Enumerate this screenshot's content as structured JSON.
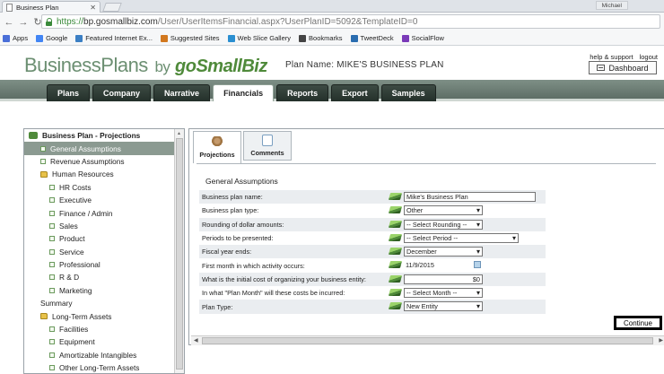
{
  "browser": {
    "tab_title": "Business Plan",
    "user_chip": "Michael",
    "url_proto": "https://",
    "url_host": "bp.gosmallbiz.com",
    "url_path": "/User/UserItemsFinancial.aspx?UserPlanID=5092&TemplateID=0",
    "bookmarks": [
      "Apps",
      "Google",
      "Featured Internet Ex...",
      "Suggested Sites",
      "Web Slice Gallery",
      "Bookmarks",
      "TweetDeck",
      "SocialFlow"
    ],
    "bookmark_colors": [
      "#4a6fd8",
      "#4285f4",
      "#3b7fc4",
      "#d2781e",
      "#2a8fd1",
      "#444444",
      "#2a6db0",
      "#7a3ab8"
    ]
  },
  "header": {
    "brand_main": "BusinessPlans",
    "brand_by": "by",
    "brand_gos": "goSmallBiz",
    "plan_name": "Plan Name: MIKE'S BUSINESS PLAN",
    "help_link": "help & support",
    "logout_link": "logout",
    "dashboard_label": "Dashboard"
  },
  "nav": {
    "tabs": [
      "Plans",
      "Company",
      "Narrative",
      "Financials",
      "Reports",
      "Export",
      "Samples"
    ],
    "active": "Financials"
  },
  "sidebar": {
    "items": [
      {
        "label": "Business Plan - Projections",
        "level": 0,
        "kind": "root"
      },
      {
        "label": "General Assumptions",
        "level": 1,
        "kind": "leaf",
        "selected": true
      },
      {
        "label": "Revenue Assumptions",
        "level": 1,
        "kind": "leaf"
      },
      {
        "label": "Human Resources",
        "level": 1,
        "kind": "folder"
      },
      {
        "label": "HR Costs",
        "level": 2,
        "kind": "leaf"
      },
      {
        "label": "Executive",
        "level": 2,
        "kind": "leaf"
      },
      {
        "label": "Finance / Admin",
        "level": 2,
        "kind": "leaf"
      },
      {
        "label": "Sales",
        "level": 2,
        "kind": "leaf"
      },
      {
        "label": "Product",
        "level": 2,
        "kind": "leaf"
      },
      {
        "label": "Service",
        "level": 2,
        "kind": "leaf"
      },
      {
        "label": "Professional",
        "level": 2,
        "kind": "leaf"
      },
      {
        "label": "R & D",
        "level": 2,
        "kind": "leaf"
      },
      {
        "label": "Marketing",
        "level": 2,
        "kind": "leaf"
      },
      {
        "label": "Summary",
        "level": 1,
        "kind": "plain"
      },
      {
        "label": "Long-Term Assets",
        "level": 1,
        "kind": "folder"
      },
      {
        "label": "Facilities",
        "level": 2,
        "kind": "leaf"
      },
      {
        "label": "Equipment",
        "level": 2,
        "kind": "leaf"
      },
      {
        "label": "Amortizable Intangibles",
        "level": 2,
        "kind": "leaf"
      },
      {
        "label": "Other Long-Term Assets",
        "level": 2,
        "kind": "leaf"
      }
    ]
  },
  "panel": {
    "subtabs": [
      "Projections",
      "Comments"
    ],
    "section_title": "General Assumptions",
    "rows": [
      {
        "label": "Business plan name:",
        "control": "text",
        "value": "Mike's Business Plan",
        "width": "wide"
      },
      {
        "label": "Business plan type:",
        "control": "select",
        "value": "Other",
        "width": "mid"
      },
      {
        "label": "Rounding of dollar amounts:",
        "control": "select",
        "value": "-- Select Rounding --",
        "width": "mid"
      },
      {
        "label": "Periods to be presented:",
        "control": "select",
        "value": "-- Select Period --",
        "width": "long"
      },
      {
        "label": "Fiscal year ends:",
        "control": "select",
        "value": "December",
        "width": "mid"
      },
      {
        "label": "First month in which activity occurs:",
        "control": "date",
        "value": "11/9/2015",
        "width": "date"
      },
      {
        "label": "What is the initial cost of organizing your business entity:",
        "control": "money",
        "value": "$0",
        "width": "mid"
      },
      {
        "label": "In what \"Plan Month\" will these costs be incurred:",
        "control": "select",
        "value": "-- Select Month --",
        "width": "mid"
      },
      {
        "label": "Plan Type:",
        "control": "select",
        "value": "New Entity",
        "width": "mid"
      }
    ],
    "continue_label": "Continue"
  }
}
